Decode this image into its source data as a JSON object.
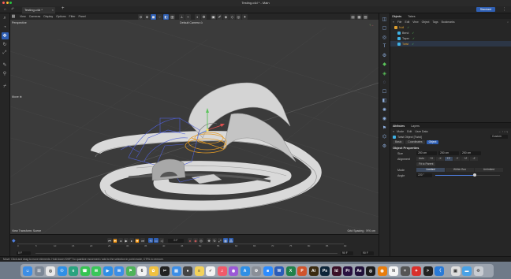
{
  "window": {
    "title": "Testing.c4d * - Main",
    "doc_tab": "Testing.c4d *",
    "layout": "Standard"
  },
  "viewport": {
    "menu": [
      "View",
      "Cameras",
      "Display",
      "Options",
      "Filter",
      "Panel"
    ],
    "projection": "Perspective",
    "camera": "Default Camera ⊙",
    "tool_label": "Move ⊕",
    "bottom_left": "View Transform: Scene",
    "bottom_right": "Grid Spacing : 500 cm"
  },
  "objects_panel": {
    "tabs": [
      "Objects",
      "Takes"
    ],
    "menu": [
      "File",
      "Edit",
      "View",
      "Object",
      "Tags",
      "Bookmarks"
    ],
    "items": [
      {
        "name": "Null",
        "color": "#e0a030"
      },
      {
        "name": "Bend",
        "color": "#3fb2e6"
      },
      {
        "name": "Taper",
        "color": "#3fb2e6"
      },
      {
        "name": "Twist",
        "color": "#3fb2e6"
      }
    ]
  },
  "attributes_panel": {
    "tabs": [
      "Attributes",
      "Layers"
    ],
    "menu": [
      "Mode",
      "Edit",
      "User Data"
    ],
    "object_name": "Twist Object [Twist]",
    "mode_dropdown": "Custom",
    "sub_tabs": [
      "Basic",
      "Coordinates",
      "Object"
    ],
    "section": "Object Properties",
    "size_label": "Size",
    "size_values": [
      "250 cm",
      "250 cm",
      "250 cm"
    ],
    "alignment_label": "Alignment",
    "alignment_options": [
      "Auto",
      "+X",
      "-X",
      "+Y",
      "-Y",
      "+Z",
      "-Z"
    ],
    "fit_button": "Fit to Parent",
    "mode_label": "Mode",
    "mode_options": [
      "Limited",
      "Within Box",
      "Unlimited"
    ],
    "angle_label": "Angle",
    "angle_value": "220 °",
    "angle_fraction": 0.61
  },
  "timeline": {
    "current_frame": "0 F",
    "start": "0 F",
    "end_a": "90 F",
    "end_b": "90 F",
    "ticks": [
      "0",
      "5",
      "10",
      "15",
      "20",
      "25",
      "30",
      "35",
      "40",
      "45",
      "50",
      "55",
      "60",
      "65",
      "70",
      "75",
      "80",
      "85",
      "90"
    ]
  },
  "status": {
    "text": "Move: Click and drag to move elements. Hold down SHIFT to quantize movement / add to the selection in point mode, CTRL to remove."
  },
  "dock": {
    "apps": [
      {
        "name": "finder",
        "color": "#3d8ee6",
        "glyph": "☺"
      },
      {
        "name": "launchpad",
        "color": "#7b8796",
        "glyph": "☷"
      },
      {
        "name": "chrome",
        "color": "#e8e8e8",
        "glyph": "◎"
      },
      {
        "name": "safari",
        "color": "#2f8fe6",
        "glyph": "☉"
      },
      {
        "name": "edge",
        "color": "#2aa37f",
        "glyph": "e"
      },
      {
        "name": "whatsapp",
        "color": "#36c452",
        "glyph": "☎"
      },
      {
        "name": "messages",
        "color": "#39c75a",
        "glyph": "✉"
      },
      {
        "name": "facetime",
        "color": "#2f8fe6",
        "glyph": "▶"
      },
      {
        "name": "mail",
        "color": "#3d8ee6",
        "glyph": "✉"
      },
      {
        "name": "maps",
        "color": "#4fb35a",
        "glyph": "⚑"
      },
      {
        "name": "calendar",
        "color": "#f2f2f2",
        "glyph": "6"
      },
      {
        "name": "photos",
        "color": "#f0c040",
        "glyph": "✿"
      },
      {
        "name": "final-cut",
        "color": "#222222",
        "glyph": "✂"
      },
      {
        "name": "keynote",
        "color": "#3d8ee6",
        "glyph": "▤"
      },
      {
        "name": "davinci",
        "color": "#444444",
        "glyph": "●"
      },
      {
        "name": "notes",
        "color": "#f3d25a",
        "glyph": "≡"
      },
      {
        "name": "reminders",
        "color": "#f2f2f2",
        "glyph": "✓"
      },
      {
        "name": "music",
        "color": "#f05a6a",
        "glyph": "♫"
      },
      {
        "name": "podcasts",
        "color": "#9b59d6",
        "glyph": "◉"
      },
      {
        "name": "app-store",
        "color": "#2f8fe6",
        "glyph": "A"
      },
      {
        "name": "system-settings",
        "color": "#8a8f98",
        "glyph": "⚙"
      },
      {
        "name": "zoom",
        "color": "#2d8cff",
        "glyph": "■"
      },
      {
        "name": "word",
        "color": "#2b5cb8",
        "glyph": "W"
      },
      {
        "name": "excel",
        "color": "#20814a",
        "glyph": "X"
      },
      {
        "name": "powerpoint",
        "color": "#d0542c",
        "glyph": "P"
      },
      {
        "name": "illustrator",
        "color": "#3a2a10",
        "glyph": "Ai"
      },
      {
        "name": "photoshop",
        "color": "#0d2438",
        "glyph": "Ps"
      },
      {
        "name": "indesign",
        "color": "#3a0f26",
        "glyph": "Id"
      },
      {
        "name": "premiere",
        "color": "#2a1240",
        "glyph": "Pr"
      },
      {
        "name": "after-effects",
        "color": "#22123a",
        "glyph": "Ae"
      },
      {
        "name": "cinema4d",
        "color": "#1c1c1c",
        "glyph": "◎"
      },
      {
        "name": "blender",
        "color": "#e87d0d",
        "glyph": "◉"
      },
      {
        "name": "notion",
        "color": "#f5f5f5",
        "glyph": "N"
      },
      {
        "name": "calculator",
        "color": "#555555",
        "glyph": "="
      },
      {
        "name": "acrobat",
        "color": "#d9302c",
        "glyph": "✦"
      },
      {
        "name": "terminal",
        "color": "#222222",
        "glyph": ">"
      },
      {
        "name": "vscode",
        "color": "#2a7ad6",
        "glyph": "〈"
      },
      {
        "name": "screenshot",
        "color": "#dddddd",
        "glyph": "▣"
      },
      {
        "name": "folder",
        "color": "#4aa2e6",
        "glyph": "▬"
      },
      {
        "name": "trash",
        "color": "#c8ccd2",
        "glyph": "♲"
      }
    ]
  }
}
